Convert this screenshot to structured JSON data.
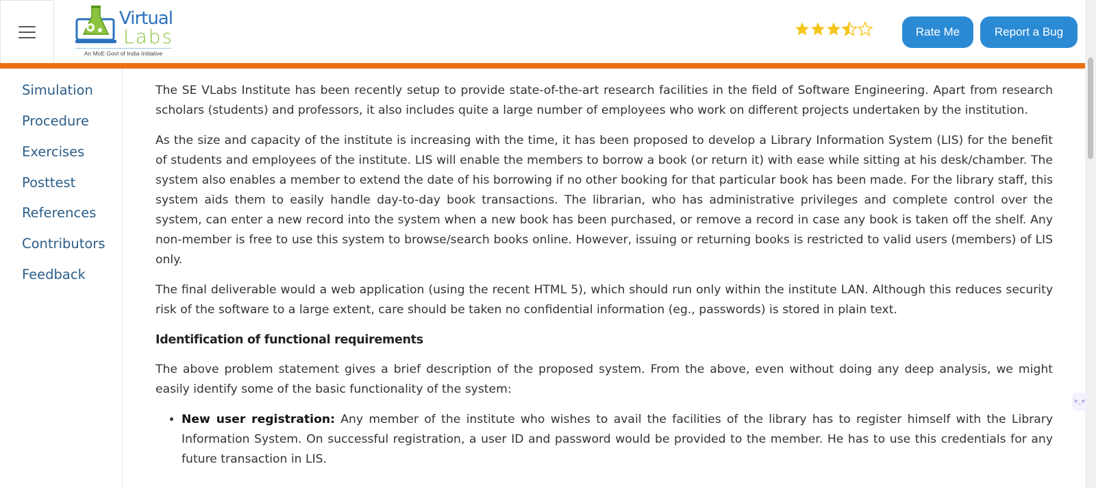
{
  "header": {
    "logo": {
      "line1": "Virtual",
      "line2": "Labs",
      "tagline": "An MoE Govt of India Initiative"
    },
    "rating": {
      "value": 3.5,
      "max": 5
    },
    "rate_label": "Rate Me",
    "bug_label": "Report a Bug"
  },
  "colors": {
    "accent_bar": "#ec6f12",
    "button": "#2b8ad4",
    "nav_link": "#2b5d87",
    "star": "#f5c518"
  },
  "sidebar": {
    "items": [
      "Simulation",
      "Procedure",
      "Exercises",
      "Posttest",
      "References",
      "Contributors",
      "Feedback"
    ]
  },
  "content": {
    "p1": "The SE VLabs Institute has been recently setup to provide state-of-the-art research facilities in the field of Software Engineering. Apart from research scholars (students) and professors, it also includes quite a large number of employees who work on different projects undertaken by the institution.",
    "p2": "As the size and capacity of the institute is increasing with the time, it has been proposed to develop a Library Information System (LIS) for the benefit of students and employees of the institute. LIS will enable the members to borrow a book (or return it) with ease while sitting at his desk/chamber. The system also enables a member to extend the date of his borrowing if no other booking for that particular book has been made. For the library staff, this system aids them to easily handle day-to-day book transactions. The librarian, who has administrative privileges and complete control over the system, can enter a new record into the system when a new book has been purchased, or remove a record in case any book is taken off the shelf. Any non-member is free to use this system to browse/search books online. However, issuing or returning books is restricted to valid users (members) of LIS only.",
    "p3": "The final deliverable would a web application (using the recent HTML 5), which should run only within the institute LAN. Although this reduces security risk of the software to a large extent, care should be taken no confidential information (eg., passwords) is stored in plain text.",
    "heading": "Identification of functional requirements",
    "p4": "The above problem statement gives a brief description of the proposed system. From the above, even without doing any deep analysis, we might easily identify some of the basic functionality of the system:",
    "bullets": [
      {
        "title": "New user registration:",
        "text": " Any member of the institute who wishes to avail the facilities of the library has to register himself with the Library Information System. On successful registration, a user ID and password would be provided to the member. He has to use this credentials for any future transaction in LIS."
      }
    ]
  }
}
